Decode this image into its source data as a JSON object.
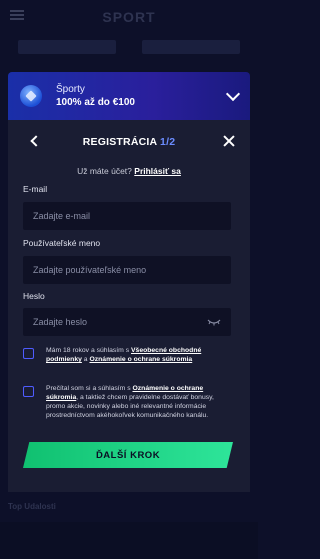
{
  "background": {
    "logo": "SPORT",
    "tabs": [
      "",
      ""
    ],
    "footer_left": "Top Udalosti",
    "footer_right": "",
    "bottom_amount": ""
  },
  "promo": {
    "title": "Športy",
    "subtitle": "100% až do €100",
    "icon": "soccer-ball-icon"
  },
  "modal": {
    "title": "REGISTRÁCIA",
    "step": "1/2",
    "login_prompt": "Už máte účet?",
    "login_link": "Prihlásiť sa",
    "email_label": "E-mail",
    "email_placeholder": "Zadajte e-mail",
    "username_label": "Používateľské meno",
    "username_placeholder": "Zadajte používateľské meno",
    "password_label": "Heslo",
    "password_placeholder": "Zadajte heslo",
    "consent1_prefix": "Mám 18 rokov a súhlasím s ",
    "consent1_link1": "Všeobecné obchodné podmienky",
    "consent1_mid": " a ",
    "consent1_link2": "Oznámenie o ochrane súkromia",
    "consent2_prefix": "Prečítal som si a súhlasím s ",
    "consent2_link": "Oznámenie o ochrane súkromia",
    "consent2_suffix": ", a taktiež chcem pravidelne dostávať bonusy, promo akcie, novinky alebo iné relevantné informácie prostredníctvom akéhokoľvek komunikačného kanálu.",
    "next_button": "ĎALŠÍ KROK"
  },
  "colors": {
    "accent": "#4f5cff",
    "button": "#1fd184",
    "modal_bg": "#1a1d33",
    "promo_bg": "#1a2fa8"
  }
}
